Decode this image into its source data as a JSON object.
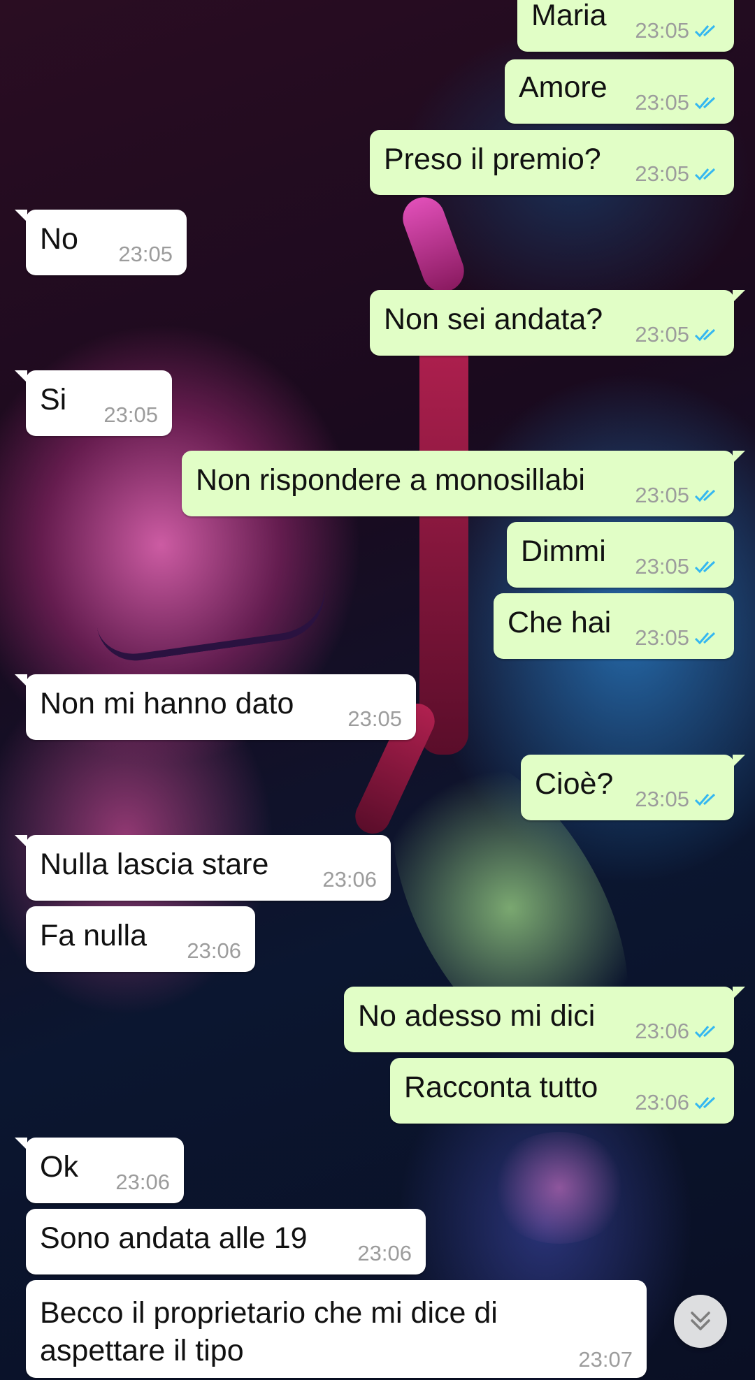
{
  "colors": {
    "outgoing_bubble": "#e1fec6",
    "incoming_bubble": "#ffffff",
    "timestamp": "#9c9c9c",
    "read_ticks": "#34b7f1"
  },
  "messages": [
    {
      "direction": "out",
      "text": "Maria",
      "time": "23:05",
      "status": "read"
    },
    {
      "direction": "out",
      "text": "Amore",
      "time": "23:05",
      "status": "read"
    },
    {
      "direction": "out",
      "text": "Preso il premio?",
      "time": "23:05",
      "status": "read"
    },
    {
      "direction": "in",
      "text": "No",
      "time": "23:05"
    },
    {
      "direction": "out",
      "text": "Non sei andata?",
      "time": "23:05",
      "status": "read"
    },
    {
      "direction": "in",
      "text": "Si",
      "time": "23:05"
    },
    {
      "direction": "out",
      "text": "Non rispondere a monosillabi",
      "time": "23:05",
      "status": "read"
    },
    {
      "direction": "out",
      "text": "Dimmi",
      "time": "23:05",
      "status": "read"
    },
    {
      "direction": "out",
      "text": "Che hai",
      "time": "23:05",
      "status": "read"
    },
    {
      "direction": "in",
      "text": "Non mi hanno dato",
      "time": "23:05"
    },
    {
      "direction": "out",
      "text": "Cioè?",
      "time": "23:05",
      "status": "read"
    },
    {
      "direction": "in",
      "text": "Nulla lascia stare",
      "time": "23:06"
    },
    {
      "direction": "in",
      "text": "Fa nulla",
      "time": "23:06"
    },
    {
      "direction": "out",
      "text": "No adesso mi dici",
      "time": "23:06",
      "status": "read"
    },
    {
      "direction": "out",
      "text": "Racconta tutto",
      "time": "23:06",
      "status": "read"
    },
    {
      "direction": "in",
      "text": "Ok",
      "time": "23:06"
    },
    {
      "direction": "in",
      "text": "Sono andata alle 19",
      "time": "23:06"
    },
    {
      "direction": "in",
      "text": "Becco il proprietario che mi dice di aspettare il tipo",
      "text_lines": [
        "Becco il proprietario che mi dice di",
        "aspettare il tipo"
      ],
      "time": "23:07"
    }
  ],
  "scroll_button_icon": "double-chevron-down-icon"
}
